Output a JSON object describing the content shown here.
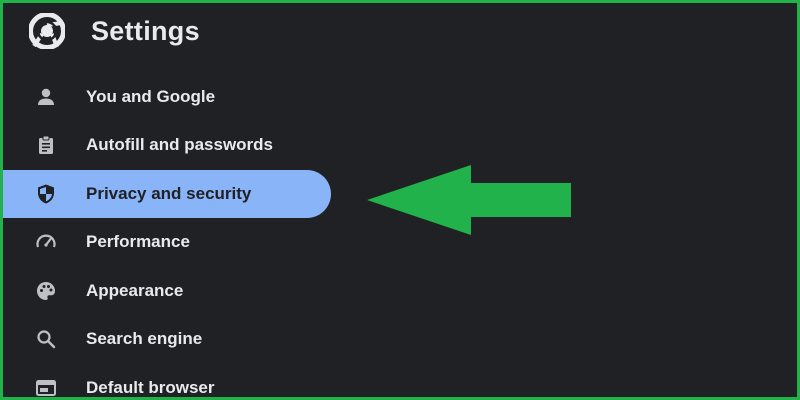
{
  "header": {
    "title": "Settings",
    "logo_icon": "chrome-logo-icon"
  },
  "nav": {
    "items": [
      {
        "label": "You and Google",
        "icon": "person-icon",
        "active": false
      },
      {
        "label": "Autofill and passwords",
        "icon": "clipboard-icon",
        "active": false
      },
      {
        "label": "Privacy and security",
        "icon": "shield-icon",
        "active": true
      },
      {
        "label": "Performance",
        "icon": "speedometer-icon",
        "active": false
      },
      {
        "label": "Appearance",
        "icon": "palette-icon",
        "active": false
      },
      {
        "label": "Search engine",
        "icon": "search-icon",
        "active": false
      },
      {
        "label": "Default browser",
        "icon": "browser-window-icon",
        "active": false
      }
    ]
  },
  "annotation": {
    "icon": "green-arrow-left-icon",
    "color": "#22b24c"
  },
  "colors": {
    "background": "#202124",
    "text": "#e8eaed",
    "active_highlight": "#8ab4f8",
    "frame_border": "#22b24c"
  }
}
